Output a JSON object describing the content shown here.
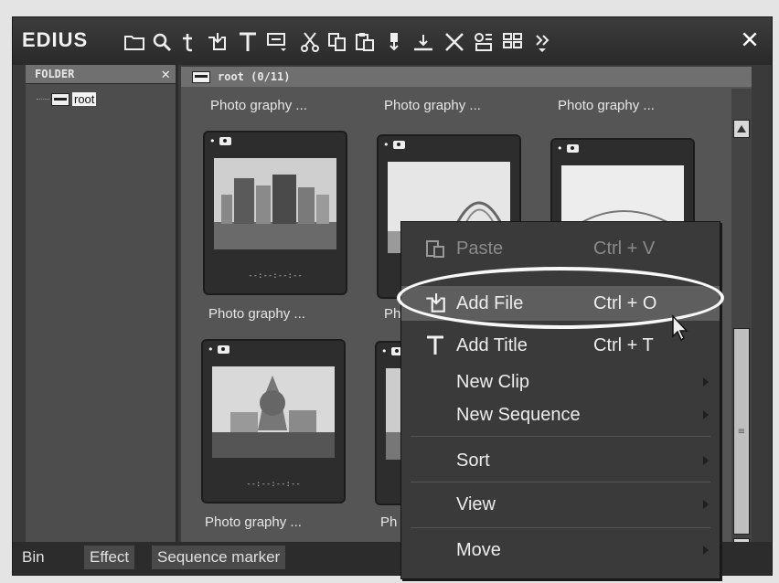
{
  "app": {
    "title": "EDIUS"
  },
  "toolbar": {
    "icons": [
      "new-folder-icon",
      "search-icon",
      "t-icon",
      "add-file-icon",
      "title-icon",
      "monitor-dropdown-icon",
      "cut-icon",
      "copy-icon",
      "paste-icon",
      "insert-icon",
      "overwrite-icon",
      "delete-icon",
      "properties-icon",
      "view-dropdown-icon",
      "more-icon"
    ]
  },
  "folder_panel": {
    "header": "FOLDER",
    "root_label": "root"
  },
  "clip_panel": {
    "header": "root (0/11)",
    "top_labels": [
      "Photo graphy ...",
      "Photo graphy ...",
      "Photo graphy ..."
    ],
    "mid_labels": [
      "Photo graphy ...",
      "Ph"
    ],
    "bottom_labels": [
      "Photo graphy ...",
      "Ph"
    ],
    "timecode": "--:--:--:--"
  },
  "tabs": [
    "Bin",
    "Effect",
    "Sequence marker"
  ],
  "context_menu": {
    "items": [
      {
        "label": "Paste",
        "shortcut": "Ctrl + V",
        "disabled": true
      },
      {
        "label": "Add File",
        "shortcut": "Ctrl + O",
        "highlighted": true
      },
      {
        "label": "Add Title",
        "shortcut": "Ctrl + T"
      },
      {
        "label": "New Clip",
        "submenu": true
      },
      {
        "label": "New Sequence",
        "submenu": true
      },
      {
        "label": "Sort",
        "submenu": true
      },
      {
        "label": "View",
        "submenu": true
      },
      {
        "label": "Move",
        "submenu": true
      }
    ]
  },
  "colors": {
    "window_bg": "#3a3a3a",
    "header_bg": "#707070",
    "highlight_oval": "#f8f8f8"
  }
}
